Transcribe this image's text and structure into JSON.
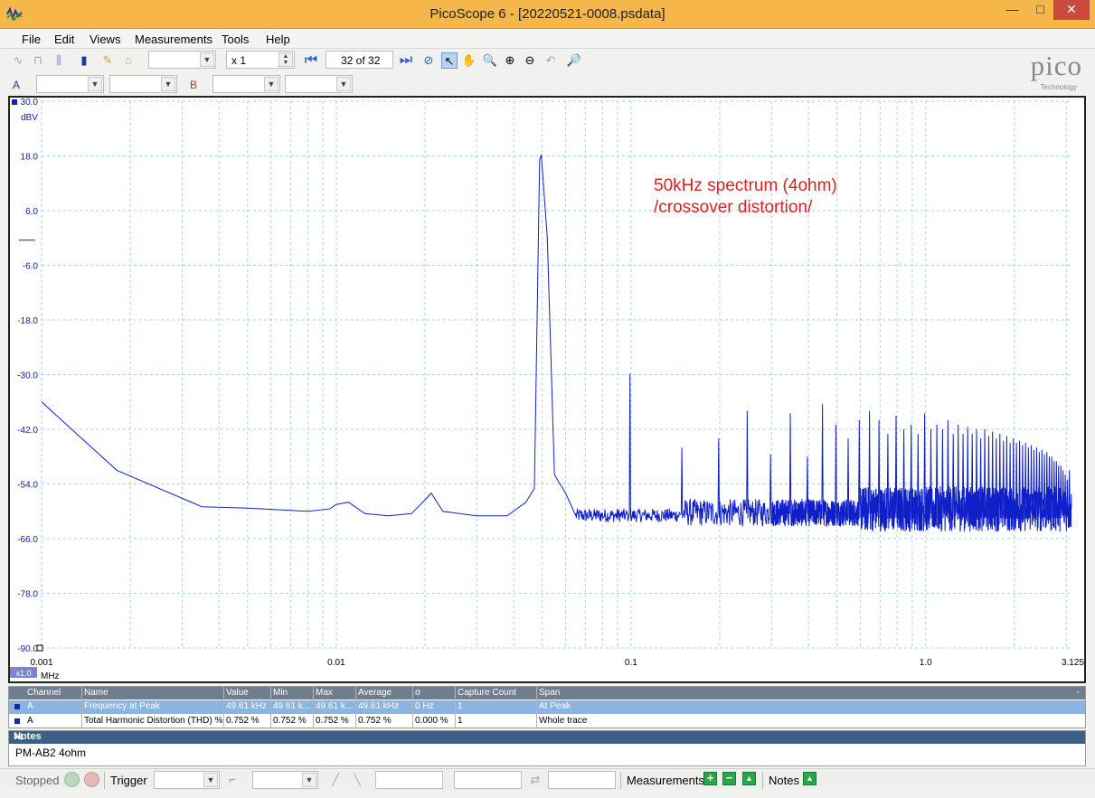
{
  "window": {
    "title": "PicoScope 6 - [20220521-0008.psdata]",
    "min": "—",
    "max": "□",
    "close": "✕"
  },
  "menu": {
    "file": "File",
    "edit": "Edit",
    "views": "Views",
    "measurements": "Measurements",
    "tools": "Tools",
    "help": "Help"
  },
  "toolbar": {
    "zoom_factor": "x 1",
    "buffer_position": "32 of 32"
  },
  "channels": {
    "a_label": "A",
    "b_label": "B"
  },
  "logo": {
    "word": "pico",
    "sub": "Technology"
  },
  "plot": {
    "y_unit": "dBV",
    "x_unit": "MHz",
    "x_scale_badge": "x1.0",
    "annotation_line1": "50kHz spectrum (4ohm)",
    "annotation_line2": "/crossover distortion/",
    "trace_color": "#1020c8"
  },
  "chart_data": {
    "type": "line",
    "x_scale": "log",
    "xlim": [
      0.001,
      3.125
    ],
    "ylim": [
      -90,
      30
    ],
    "y_ticks": [
      "30.0",
      "18.0",
      "6.0",
      "-6.0",
      "-18.0",
      "-30.0",
      "-42.0",
      "-54.0",
      "-66.0",
      "-78.0",
      "-90.0"
    ],
    "x_ticks": [
      "0.001",
      "0.01",
      "0.1",
      "1.0",
      "3.125"
    ],
    "grid": true,
    "fundamental": {
      "x": 0.0496,
      "y": 18.3
    },
    "baseline_points": [
      [
        0.001,
        -36
      ],
      [
        0.0018,
        -51
      ],
      [
        0.0035,
        -59
      ],
      [
        0.005,
        -59.3
      ],
      [
        0.008,
        -60
      ],
      [
        0.0095,
        -59.5
      ],
      [
        0.01,
        -58.5
      ],
      [
        0.011,
        -58
      ],
      [
        0.0125,
        -60.5
      ],
      [
        0.015,
        -61
      ],
      [
        0.018,
        -60.5
      ],
      [
        0.02,
        -57.5
      ],
      [
        0.021,
        -56
      ],
      [
        0.023,
        -60
      ],
      [
        0.03,
        -61
      ],
      [
        0.038,
        -61
      ],
      [
        0.044,
        -58
      ],
      [
        0.047,
        -55
      ],
      [
        0.049,
        17
      ],
      [
        0.0496,
        18.3
      ],
      [
        0.052,
        0
      ],
      [
        0.055,
        -52
      ],
      [
        0.06,
        -56
      ],
      [
        0.065,
        -61
      ]
    ],
    "harmonics_dBV": [
      [
        0.0992,
        -29.8
      ],
      [
        0.1488,
        -46
      ],
      [
        0.1984,
        -44
      ],
      [
        0.248,
        -38
      ],
      [
        0.2976,
        -47.5
      ],
      [
        0.3472,
        -38.5
      ],
      [
        0.3968,
        -48
      ],
      [
        0.4464,
        -36.5
      ],
      [
        0.496,
        -41
      ],
      [
        0.5456,
        -44
      ],
      [
        0.5952,
        -40
      ],
      [
        0.6448,
        -38
      ],
      [
        0.6944,
        -40
      ],
      [
        0.744,
        -43
      ],
      [
        0.7936,
        -39
      ],
      [
        0.8432,
        -42
      ],
      [
        0.8928,
        -41
      ],
      [
        0.9424,
        -43
      ],
      [
        0.992,
        -38.5
      ],
      [
        1.0416,
        -42
      ],
      [
        1.0912,
        -41
      ],
      [
        1.1408,
        -42
      ],
      [
        1.1904,
        -40
      ],
      [
        1.24,
        -43
      ],
      [
        1.2896,
        -41
      ],
      [
        1.3392,
        -43
      ],
      [
        1.3888,
        -41.5
      ],
      [
        1.4384,
        -43
      ],
      [
        1.488,
        -42
      ],
      [
        1.5376,
        -44
      ],
      [
        1.5872,
        -42
      ],
      [
        1.6368,
        -43.5
      ],
      [
        1.6864,
        -42.5
      ],
      [
        1.736,
        -44
      ],
      [
        1.7856,
        -43
      ],
      [
        1.8352,
        -44.5
      ],
      [
        1.8848,
        -43.5
      ],
      [
        1.9344,
        -45
      ],
      [
        1.984,
        -44
      ],
      [
        2.0336,
        -45
      ],
      [
        2.0832,
        -44.5
      ],
      [
        2.1328,
        -45.5
      ],
      [
        2.1824,
        -45
      ],
      [
        2.232,
        -46
      ],
      [
        2.2816,
        -45.5
      ],
      [
        2.3312,
        -46.5
      ],
      [
        2.3808,
        -46
      ],
      [
        2.4304,
        -47
      ],
      [
        2.48,
        -46.5
      ],
      [
        2.5296,
        -47.5
      ],
      [
        2.5792,
        -47
      ],
      [
        2.6288,
        -48
      ],
      [
        2.6784,
        -48
      ],
      [
        2.728,
        -49
      ],
      [
        2.7776,
        -49
      ],
      [
        2.8272,
        -50
      ],
      [
        2.8768,
        -50
      ],
      [
        2.9264,
        -51
      ],
      [
        2.976,
        -52
      ],
      [
        3.0256,
        -53
      ],
      [
        3.075,
        -51
      ]
    ],
    "noise_floor_dBV": -61.5
  },
  "measurements": {
    "headers": [
      "Channel",
      "Name",
      "Value",
      "Min",
      "Max",
      "Average",
      "σ",
      "Capture Count",
      "Span"
    ],
    "rows": [
      [
        "A",
        "Frequency at Peak",
        "49.61 kHz",
        "49.61 k...",
        "49.61 k...",
        "49.61 kHz",
        "0 Hz",
        "1",
        "At Peak"
      ],
      [
        "A",
        "Total Harmonic Distortion (THD) %",
        "0.752 %",
        "0.752 %",
        "0.752 %",
        "0.752 %",
        "0.000 %",
        "1",
        "Whole trace"
      ]
    ],
    "collapse": "-"
  },
  "notes": {
    "header": "Notes",
    "text": "PM-AB2 4ohm",
    "pin": "⊣",
    "close": "✕"
  },
  "status": {
    "state": "Stopped",
    "trigger": "Trigger",
    "measurements": "Measurements",
    "notes": "Notes",
    "add": "+",
    "remove": "−",
    "edit": "▲"
  }
}
